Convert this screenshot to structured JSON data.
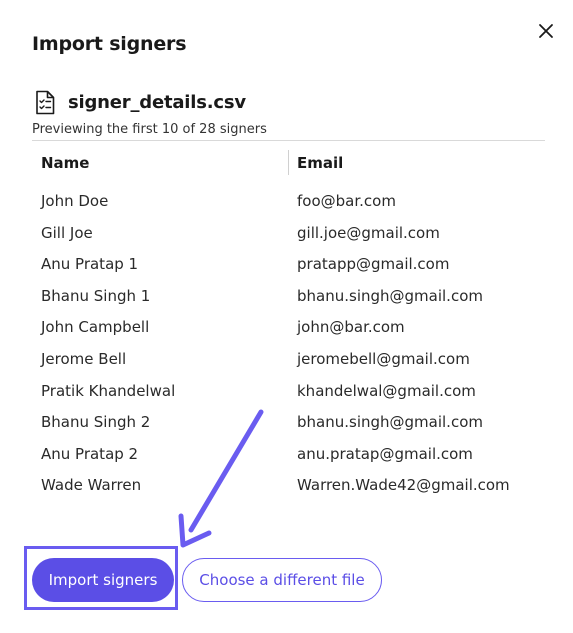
{
  "dialog": {
    "title": "Import signers",
    "close_icon": "close-icon"
  },
  "file": {
    "icon": "file-checklist-icon",
    "name": "signer_details.csv",
    "preview_text": "Previewing the first 10 of 28 signers"
  },
  "table": {
    "headers": {
      "name": "Name",
      "email": "Email"
    },
    "rows": [
      {
        "name": "John Doe",
        "email": "foo@bar.com"
      },
      {
        "name": "Gill Joe",
        "email": "gill.joe@gmail.com"
      },
      {
        "name": "Anu Pratap 1",
        "email": "pratapp@gmail.com"
      },
      {
        "name": "Bhanu Singh 1",
        "email": "bhanu.singh@gmail.com"
      },
      {
        "name": "John Campbell",
        "email": "john@bar.com"
      },
      {
        "name": "Jerome Bell",
        "email": "jeromebell@gmail.com"
      },
      {
        "name": "Pratik Khandelwal",
        "email": "khandelwal@gmail.com"
      },
      {
        "name": "Bhanu Singh 2",
        "email": "bhanu.singh@gmail.com"
      },
      {
        "name": "Anu Pratap 2",
        "email": "anu.pratap@gmail.com"
      },
      {
        "name": "Wade Warren",
        "email": "Warren.Wade42@gmail.com"
      }
    ]
  },
  "actions": {
    "import_label": "Import signers",
    "choose_label": "Choose a different file"
  },
  "colors": {
    "accent": "#5b4ee6",
    "annotation": "#6a5cf0"
  }
}
